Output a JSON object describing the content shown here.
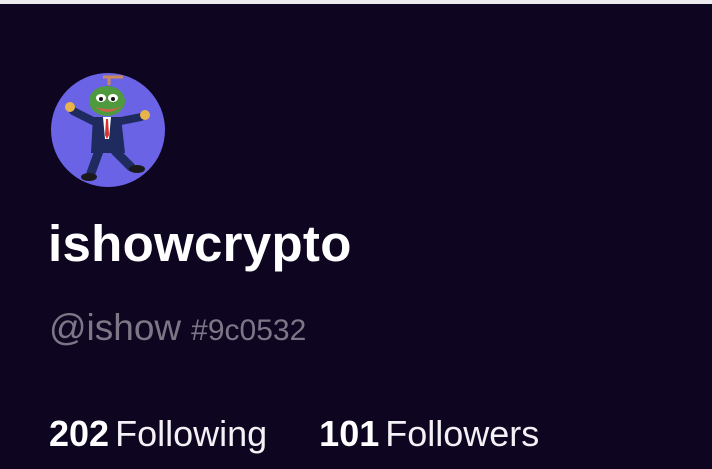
{
  "profile": {
    "display_name": "ishowcrypto",
    "handle": "@ishow",
    "tag": "#9c0532",
    "avatar_description": "pepe-frog-in-suit-dancing"
  },
  "stats": {
    "following_count": "202",
    "following_label": "Following",
    "followers_count": "101",
    "followers_label": "Followers"
  },
  "colors": {
    "background": "#0e0520",
    "avatar_bg": "#6a63e6",
    "muted_text": "#7b7787",
    "primary_text": "#ffffff"
  }
}
